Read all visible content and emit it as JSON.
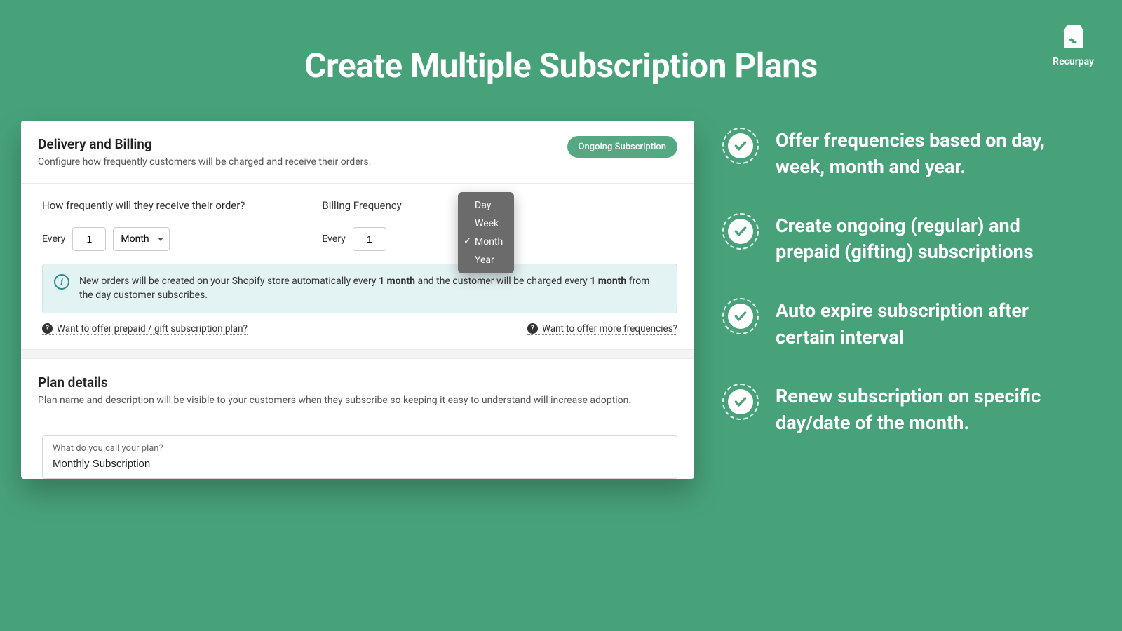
{
  "brand": {
    "name": "Recurpay"
  },
  "title": "Create Multiple Subscription Plans",
  "card": {
    "delivery": {
      "heading": "Delivery and Billing",
      "sub": "Configure how frequently customers will be charged and receive their orders.",
      "pill": "Ongoing Subscription",
      "order_freq_label": "How frequently will they receive their order?",
      "billing_freq_label": "Billing Frequency",
      "every": "Every",
      "order_value": "1",
      "order_unit": "Month",
      "billing_value": "1",
      "unit_options": [
        "Day",
        "Week",
        "Month",
        "Year"
      ],
      "unit_selected": "Month",
      "info_pre": "New orders will be created on your Shopify store automatically every ",
      "info_bold1": "1 month",
      "info_mid": " and the customer will be charged every ",
      "info_bold2": "1 month",
      "info_post": " from the day customer subscribes.",
      "hint_prepaid": "Want to offer prepaid / gift subscription plan?",
      "hint_more": "Want to offer more frequencies?"
    },
    "plan": {
      "heading": "Plan details",
      "sub": "Plan name and description will be visible to your customers when they subscribe so keeping it easy to understand will increase adoption.",
      "input_label": "What do you call your plan?",
      "input_value": "Monthly Subscription"
    }
  },
  "features": [
    "Offer frequencies based on day, week, month and year.",
    "Create ongoing (regular) and prepaid (gifting) subscriptions",
    "Auto expire subscription after certain interval",
    "Renew subscription on specific day/date of the month."
  ]
}
